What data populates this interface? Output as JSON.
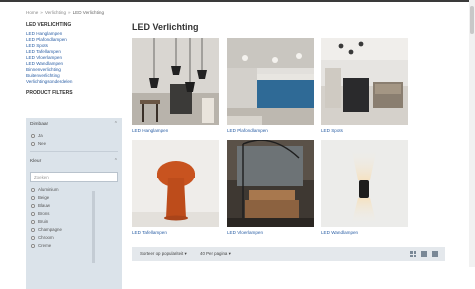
{
  "breadcrumb": {
    "home": "Home",
    "level1": "Verlichting",
    "current": "LED Verlichting"
  },
  "sidebar": {
    "heading": "LED VERLICHTING",
    "links": [
      "LED Hanglampen",
      "LED Plafondlampen",
      "LED Spots",
      "LED Tafellampen",
      "LED Vloerlampen",
      "LED Wandlampen",
      "Binnenverlichting",
      "Buitenverlichting",
      "Verlichtingsonderdelen"
    ],
    "filters_heading": "PRODUCT FILTERS"
  },
  "filters": {
    "dimbaar": {
      "label": "Dimbaar",
      "options": [
        "Ja",
        "Nee"
      ]
    },
    "kleur": {
      "label": "Kleur",
      "search_placeholder": "Zoeken",
      "options": [
        "Aluminium",
        "Beige",
        "Blauw",
        "Brons",
        "Bruin",
        "Champagne",
        "Chroom",
        "Creme"
      ]
    }
  },
  "main": {
    "title": "LED Verlichting",
    "categories": [
      {
        "label": "LED Hanglampen"
      },
      {
        "label": "LED Plafondlampen"
      },
      {
        "label": "LED Spots"
      },
      {
        "label": "LED Tafellampen"
      },
      {
        "label": "LED Vloerlampen"
      },
      {
        "label": "LED Wandlampen"
      }
    ]
  },
  "sortbar": {
    "sort": "Sorteer op populariteit",
    "per_page": "40 Per pagina",
    "caret": "▾"
  },
  "colors": {
    "link": "#2b5fa5",
    "filter_bg": "#dbe3ea",
    "sortbar_bg": "#e4e8ec"
  }
}
